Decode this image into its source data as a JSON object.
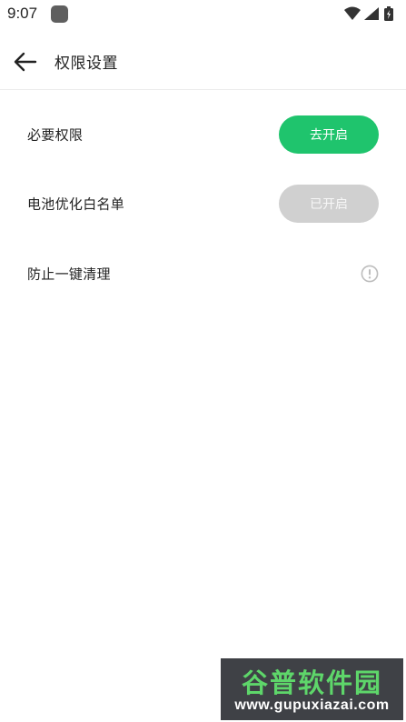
{
  "status_bar": {
    "time": "9:07",
    "icons": [
      "app-notification-icon",
      "wifi-icon",
      "signal-icon",
      "battery-icon"
    ]
  },
  "header": {
    "title": "权限设置",
    "back_icon": "arrow-left-icon"
  },
  "rows": [
    {
      "label": "必要权限",
      "action_label": "去开启",
      "state": "enabled"
    },
    {
      "label": "电池优化白名单",
      "action_label": "已开启",
      "state": "disabled"
    },
    {
      "label": "防止一键清理",
      "action_icon": "info-icon"
    }
  ],
  "colors": {
    "accent_green": "#1fc46d",
    "disabled_grey": "#d0d0d0"
  },
  "watermark": {
    "title": "谷普软件园",
    "url": "www.gupuxiazai.com"
  }
}
